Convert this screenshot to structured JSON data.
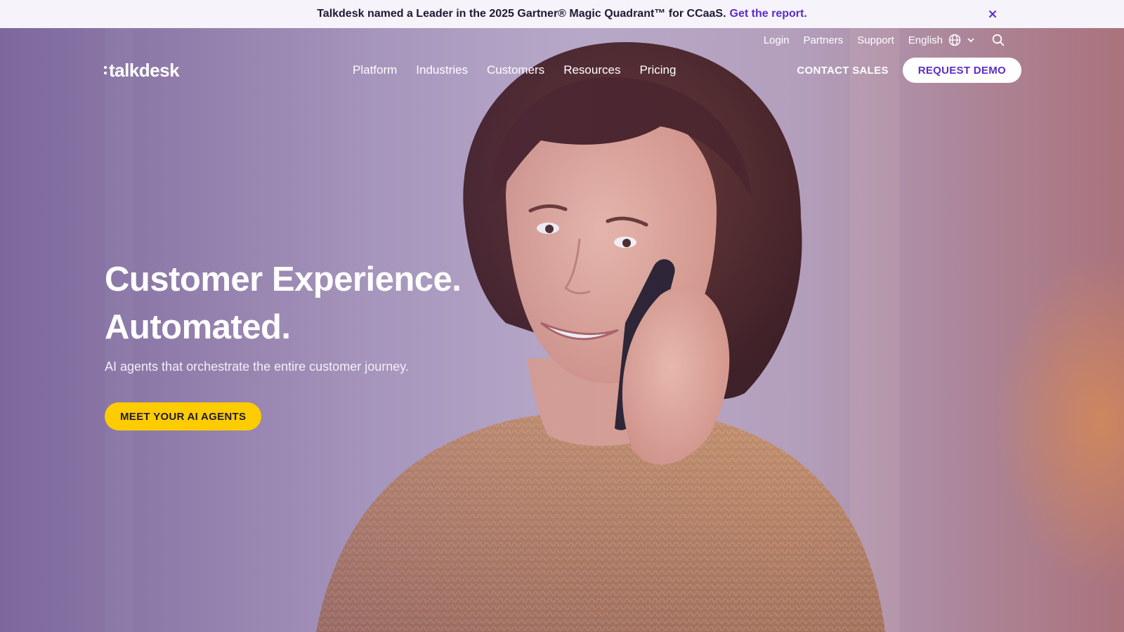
{
  "announcement": {
    "text": "Talkdesk named a Leader in the 2025 Gartner® Magic Quadrant™ for CCaaS.",
    "link_text": "Get the report.",
    "close_icon": "close-icon"
  },
  "utility_nav": {
    "login": "Login",
    "partners": "Partners",
    "support": "Support",
    "language": "English",
    "language_icon": "globe-icon",
    "search_icon": "search-icon"
  },
  "brand": {
    "logo_text": "talkdesk"
  },
  "main_nav": {
    "items": [
      {
        "label": "Platform"
      },
      {
        "label": "Industries"
      },
      {
        "label": "Customers"
      },
      {
        "label": "Resources"
      },
      {
        "label": "Pricing"
      }
    ],
    "contact_sales": "CONTACT SALES",
    "request_demo": "REQUEST DEMO"
  },
  "hero": {
    "headline_line1": "Customer Experience.",
    "headline_line2": "Automated.",
    "subheadline": "AI agents that orchestrate the entire customer journey.",
    "cta": "MEET YOUR AI AGENTS",
    "image": "woman-on-phone-photo"
  },
  "colors": {
    "accent_purple": "#5a2dc8",
    "cta_yellow": "#ffcc00",
    "announce_bg": "#f7f3fb"
  }
}
